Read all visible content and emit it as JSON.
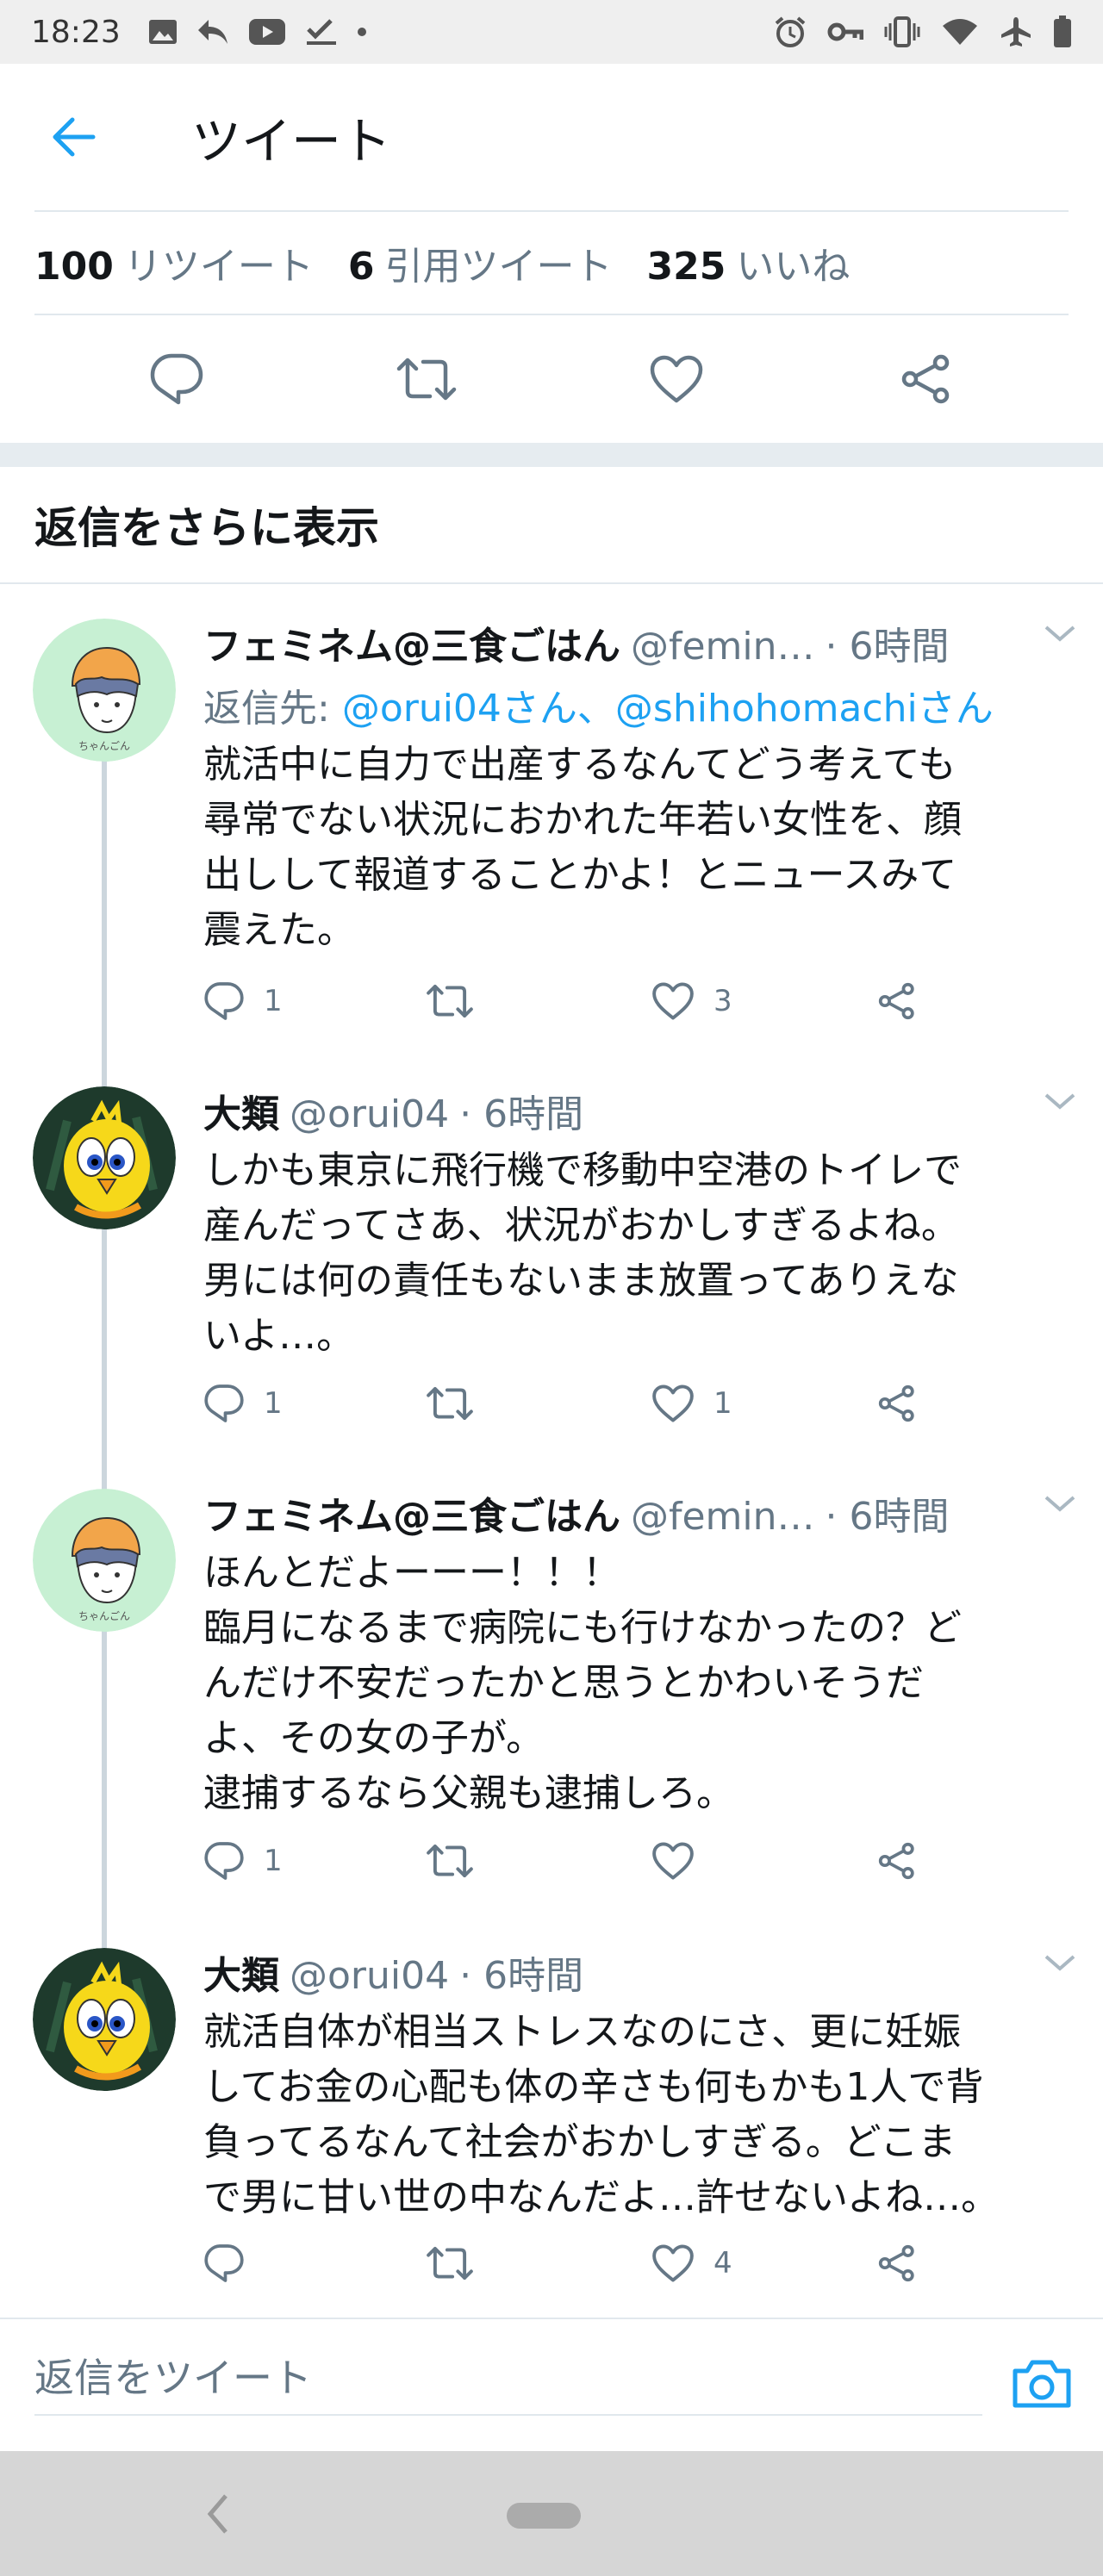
{
  "status_bar": {
    "time": "18:23"
  },
  "header": {
    "title": "ツイート"
  },
  "stats": [
    {
      "count": "100",
      "label": "リツイート"
    },
    {
      "count": "6",
      "label": "引用ツイート"
    },
    {
      "count": "325",
      "label": "いいね"
    }
  ],
  "show_more": "返信をさらに表示",
  "tweets": [
    {
      "name": "フェミネム@三食ごはん",
      "handle": "@femin…",
      "time": "· 6時間",
      "reply_prefix": "返信先: ",
      "reply_mentions": "@orui04さん、@shihohomachiさん",
      "text": "就活中に自力で出産するなんてどう考えても\n尋常でない状況におかれた年若い女性を、顔\n出しして報道することかよ！とニュースみて\n震えた。",
      "reply_count": "1",
      "retweet_count": "",
      "like_count": "3"
    },
    {
      "name": "大類",
      "handle": "@orui04",
      "time": "· 6時間",
      "text": "しかも東京に飛行機で移動中空港のトイレで\n産んだってさあ、状況がおかしすぎるよね。\n男には何の責任もないまま放置ってありえな\nいよ…。",
      "reply_count": "1",
      "retweet_count": "",
      "like_count": "1"
    },
    {
      "name": "フェミネム@三食ごはん",
      "handle": "@femin…",
      "time": "· 6時間",
      "text": "ほんとだよーーー！！！\n臨月になるまで病院にも行けなかったの？ど\nんだけ不安だったかと思うとかわいそうだ\nよ、その女の子が。\n逮捕するなら父親も逮捕しろ。",
      "reply_count": "1",
      "retweet_count": "",
      "like_count": ""
    },
    {
      "name": "大類",
      "handle": "@orui04",
      "time": "· 6時間",
      "text": "就活自体が相当ストレスなのにさ、更に妊娠\nしてお金の心配も体の辛さも何もかも1人で背\n負ってるなんて社会がおかしすぎる。どこま\nで男に甘い世の中なんだよ…許せないよね…。",
      "reply_count": "",
      "retweet_count": "",
      "like_count": "4"
    }
  ],
  "composer": {
    "placeholder": "返信をツイート"
  },
  "colors": {
    "accent": "#1da1f2",
    "muted": "#657786",
    "border": "#e1e8ed"
  },
  "icons": [
    "back-arrow-icon",
    "reply-icon",
    "retweet-icon",
    "like-icon",
    "share-icon",
    "chevron-down-icon",
    "camera-icon"
  ]
}
